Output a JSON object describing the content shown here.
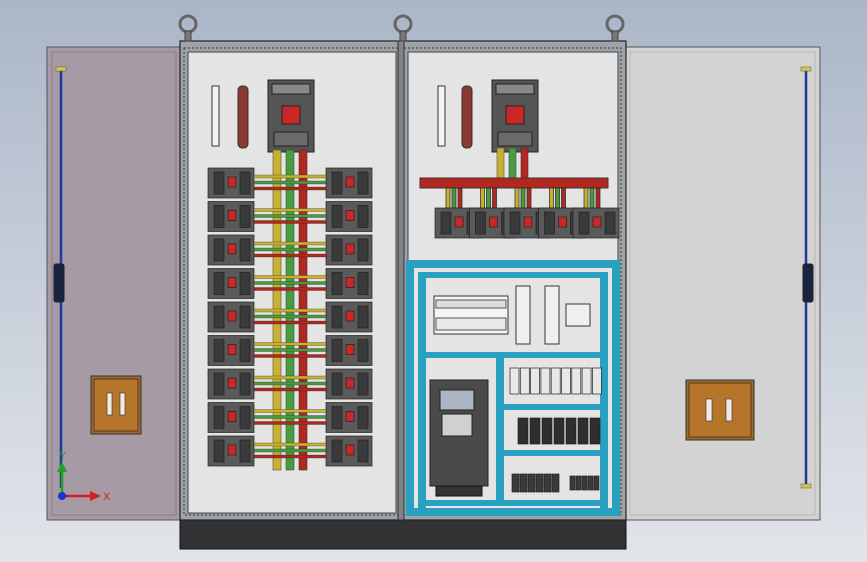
{
  "viewport": {
    "background_top": "#aab6c8",
    "background_bottom": "#e2e5ea"
  },
  "triad": {
    "x_label": "X",
    "y_label": "Y",
    "x_color": "#d42020",
    "y_color": "#1fa020",
    "z_color": "#2030c8"
  },
  "colors": {
    "cabinet_frame": "#9ea3a8",
    "mounting_plate": "#e4e4e4",
    "left_door": "#a69ba5",
    "right_door": "#d3d3d3",
    "plinth": "#303234",
    "cyan_duct": "#2aa0c0",
    "busbar_red": "#b02820",
    "busbar_yellow": "#c8b030",
    "busbar_green": "#4a9a40",
    "hinge_rod": "#1f3a9e",
    "handle_plate": "#b5752a"
  }
}
